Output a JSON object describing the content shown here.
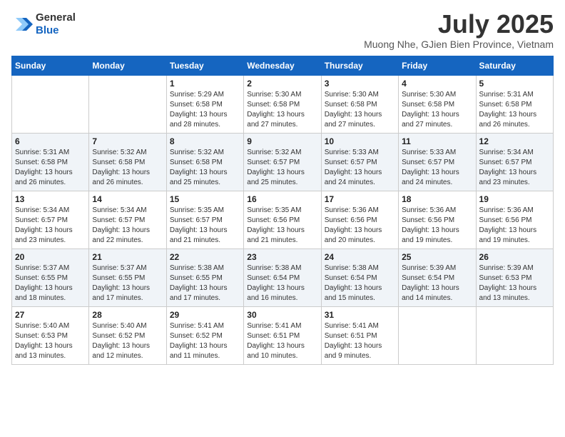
{
  "header": {
    "logo_line1": "General",
    "logo_line2": "Blue",
    "month_year": "July 2025",
    "location": "Muong Nhe, GJien Bien Province, Vietnam"
  },
  "weekdays": [
    "Sunday",
    "Monday",
    "Tuesday",
    "Wednesday",
    "Thursday",
    "Friday",
    "Saturday"
  ],
  "weeks": [
    [
      {
        "day": "",
        "sunrise": "",
        "sunset": "",
        "daylight": ""
      },
      {
        "day": "",
        "sunrise": "",
        "sunset": "",
        "daylight": ""
      },
      {
        "day": "1",
        "sunrise": "Sunrise: 5:29 AM",
        "sunset": "Sunset: 6:58 PM",
        "daylight": "Daylight: 13 hours and 28 minutes."
      },
      {
        "day": "2",
        "sunrise": "Sunrise: 5:30 AM",
        "sunset": "Sunset: 6:58 PM",
        "daylight": "Daylight: 13 hours and 27 minutes."
      },
      {
        "day": "3",
        "sunrise": "Sunrise: 5:30 AM",
        "sunset": "Sunset: 6:58 PM",
        "daylight": "Daylight: 13 hours and 27 minutes."
      },
      {
        "day": "4",
        "sunrise": "Sunrise: 5:30 AM",
        "sunset": "Sunset: 6:58 PM",
        "daylight": "Daylight: 13 hours and 27 minutes."
      },
      {
        "day": "5",
        "sunrise": "Sunrise: 5:31 AM",
        "sunset": "Sunset: 6:58 PM",
        "daylight": "Daylight: 13 hours and 26 minutes."
      }
    ],
    [
      {
        "day": "6",
        "sunrise": "Sunrise: 5:31 AM",
        "sunset": "Sunset: 6:58 PM",
        "daylight": "Daylight: 13 hours and 26 minutes."
      },
      {
        "day": "7",
        "sunrise": "Sunrise: 5:32 AM",
        "sunset": "Sunset: 6:58 PM",
        "daylight": "Daylight: 13 hours and 26 minutes."
      },
      {
        "day": "8",
        "sunrise": "Sunrise: 5:32 AM",
        "sunset": "Sunset: 6:58 PM",
        "daylight": "Daylight: 13 hours and 25 minutes."
      },
      {
        "day": "9",
        "sunrise": "Sunrise: 5:32 AM",
        "sunset": "Sunset: 6:57 PM",
        "daylight": "Daylight: 13 hours and 25 minutes."
      },
      {
        "day": "10",
        "sunrise": "Sunrise: 5:33 AM",
        "sunset": "Sunset: 6:57 PM",
        "daylight": "Daylight: 13 hours and 24 minutes."
      },
      {
        "day": "11",
        "sunrise": "Sunrise: 5:33 AM",
        "sunset": "Sunset: 6:57 PM",
        "daylight": "Daylight: 13 hours and 24 minutes."
      },
      {
        "day": "12",
        "sunrise": "Sunrise: 5:34 AM",
        "sunset": "Sunset: 6:57 PM",
        "daylight": "Daylight: 13 hours and 23 minutes."
      }
    ],
    [
      {
        "day": "13",
        "sunrise": "Sunrise: 5:34 AM",
        "sunset": "Sunset: 6:57 PM",
        "daylight": "Daylight: 13 hours and 23 minutes."
      },
      {
        "day": "14",
        "sunrise": "Sunrise: 5:34 AM",
        "sunset": "Sunset: 6:57 PM",
        "daylight": "Daylight: 13 hours and 22 minutes."
      },
      {
        "day": "15",
        "sunrise": "Sunrise: 5:35 AM",
        "sunset": "Sunset: 6:57 PM",
        "daylight": "Daylight: 13 hours and 21 minutes."
      },
      {
        "day": "16",
        "sunrise": "Sunrise: 5:35 AM",
        "sunset": "Sunset: 6:56 PM",
        "daylight": "Daylight: 13 hours and 21 minutes."
      },
      {
        "day": "17",
        "sunrise": "Sunrise: 5:36 AM",
        "sunset": "Sunset: 6:56 PM",
        "daylight": "Daylight: 13 hours and 20 minutes."
      },
      {
        "day": "18",
        "sunrise": "Sunrise: 5:36 AM",
        "sunset": "Sunset: 6:56 PM",
        "daylight": "Daylight: 13 hours and 19 minutes."
      },
      {
        "day": "19",
        "sunrise": "Sunrise: 5:36 AM",
        "sunset": "Sunset: 6:56 PM",
        "daylight": "Daylight: 13 hours and 19 minutes."
      }
    ],
    [
      {
        "day": "20",
        "sunrise": "Sunrise: 5:37 AM",
        "sunset": "Sunset: 6:55 PM",
        "daylight": "Daylight: 13 hours and 18 minutes."
      },
      {
        "day": "21",
        "sunrise": "Sunrise: 5:37 AM",
        "sunset": "Sunset: 6:55 PM",
        "daylight": "Daylight: 13 hours and 17 minutes."
      },
      {
        "day": "22",
        "sunrise": "Sunrise: 5:38 AM",
        "sunset": "Sunset: 6:55 PM",
        "daylight": "Daylight: 13 hours and 17 minutes."
      },
      {
        "day": "23",
        "sunrise": "Sunrise: 5:38 AM",
        "sunset": "Sunset: 6:54 PM",
        "daylight": "Daylight: 13 hours and 16 minutes."
      },
      {
        "day": "24",
        "sunrise": "Sunrise: 5:38 AM",
        "sunset": "Sunset: 6:54 PM",
        "daylight": "Daylight: 13 hours and 15 minutes."
      },
      {
        "day": "25",
        "sunrise": "Sunrise: 5:39 AM",
        "sunset": "Sunset: 6:54 PM",
        "daylight": "Daylight: 13 hours and 14 minutes."
      },
      {
        "day": "26",
        "sunrise": "Sunrise: 5:39 AM",
        "sunset": "Sunset: 6:53 PM",
        "daylight": "Daylight: 13 hours and 13 minutes."
      }
    ],
    [
      {
        "day": "27",
        "sunrise": "Sunrise: 5:40 AM",
        "sunset": "Sunset: 6:53 PM",
        "daylight": "Daylight: 13 hours and 13 minutes."
      },
      {
        "day": "28",
        "sunrise": "Sunrise: 5:40 AM",
        "sunset": "Sunset: 6:52 PM",
        "daylight": "Daylight: 13 hours and 12 minutes."
      },
      {
        "day": "29",
        "sunrise": "Sunrise: 5:41 AM",
        "sunset": "Sunset: 6:52 PM",
        "daylight": "Daylight: 13 hours and 11 minutes."
      },
      {
        "day": "30",
        "sunrise": "Sunrise: 5:41 AM",
        "sunset": "Sunset: 6:51 PM",
        "daylight": "Daylight: 13 hours and 10 minutes."
      },
      {
        "day": "31",
        "sunrise": "Sunrise: 5:41 AM",
        "sunset": "Sunset: 6:51 PM",
        "daylight": "Daylight: 13 hours and 9 minutes."
      },
      {
        "day": "",
        "sunrise": "",
        "sunset": "",
        "daylight": ""
      },
      {
        "day": "",
        "sunrise": "",
        "sunset": "",
        "daylight": ""
      }
    ]
  ]
}
